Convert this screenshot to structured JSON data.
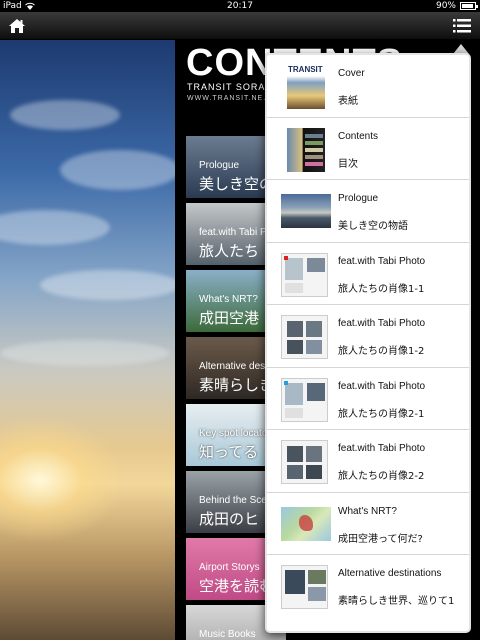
{
  "status_bar": {
    "device": "iPad",
    "time": "20:17",
    "battery": "90%"
  },
  "toolbar": {
    "home_icon": "home-icon",
    "menu_icon": "list-menu-icon"
  },
  "page": {
    "title": "CONTENTS",
    "subtitle": "TRANSIT SORA",
    "url": "WWW.TRANSIT.NE.JP",
    "toc": [
      {
        "en": "Prologue",
        "ja": "美しき空の"
      },
      {
        "en": "feat.with Tabi P",
        "ja": "旅人たち"
      },
      {
        "en": "What's NRT?",
        "ja": "成田空港"
      },
      {
        "en": "Alternative destin",
        "ja": "素晴らしき"
      },
      {
        "en": "Key spot locato",
        "ja": "知ってる"
      },
      {
        "en": "Behind the Sce",
        "ja": "成田のヒ"
      },
      {
        "en": "Airport Storys",
        "ja": "空港を読む"
      },
      {
        "en": "Music Books",
        "ja": ""
      }
    ]
  },
  "popover": {
    "items": [
      {
        "title": "Cover",
        "subtitle": "表紙",
        "thumb_label": "TRANSIT"
      },
      {
        "title": "Contents",
        "subtitle": "目次"
      },
      {
        "title": "Prologue",
        "subtitle": "美しき空の物語"
      },
      {
        "title": "feat.with Tabi Photo",
        "subtitle": "旅人たちの肖像1-1"
      },
      {
        "title": "feat.with Tabi Photo",
        "subtitle": "旅人たちの肖像1-2"
      },
      {
        "title": "feat.with Tabi Photo",
        "subtitle": "旅人たちの肖像2-1"
      },
      {
        "title": "feat.with Tabi Photo",
        "subtitle": "旅人たちの肖像2-2"
      },
      {
        "title": "What's NRT?",
        "subtitle": "成田空港って何だ?"
      },
      {
        "title": "Alternative destinations",
        "subtitle": "素晴らしき世界、巡りて1"
      }
    ]
  }
}
